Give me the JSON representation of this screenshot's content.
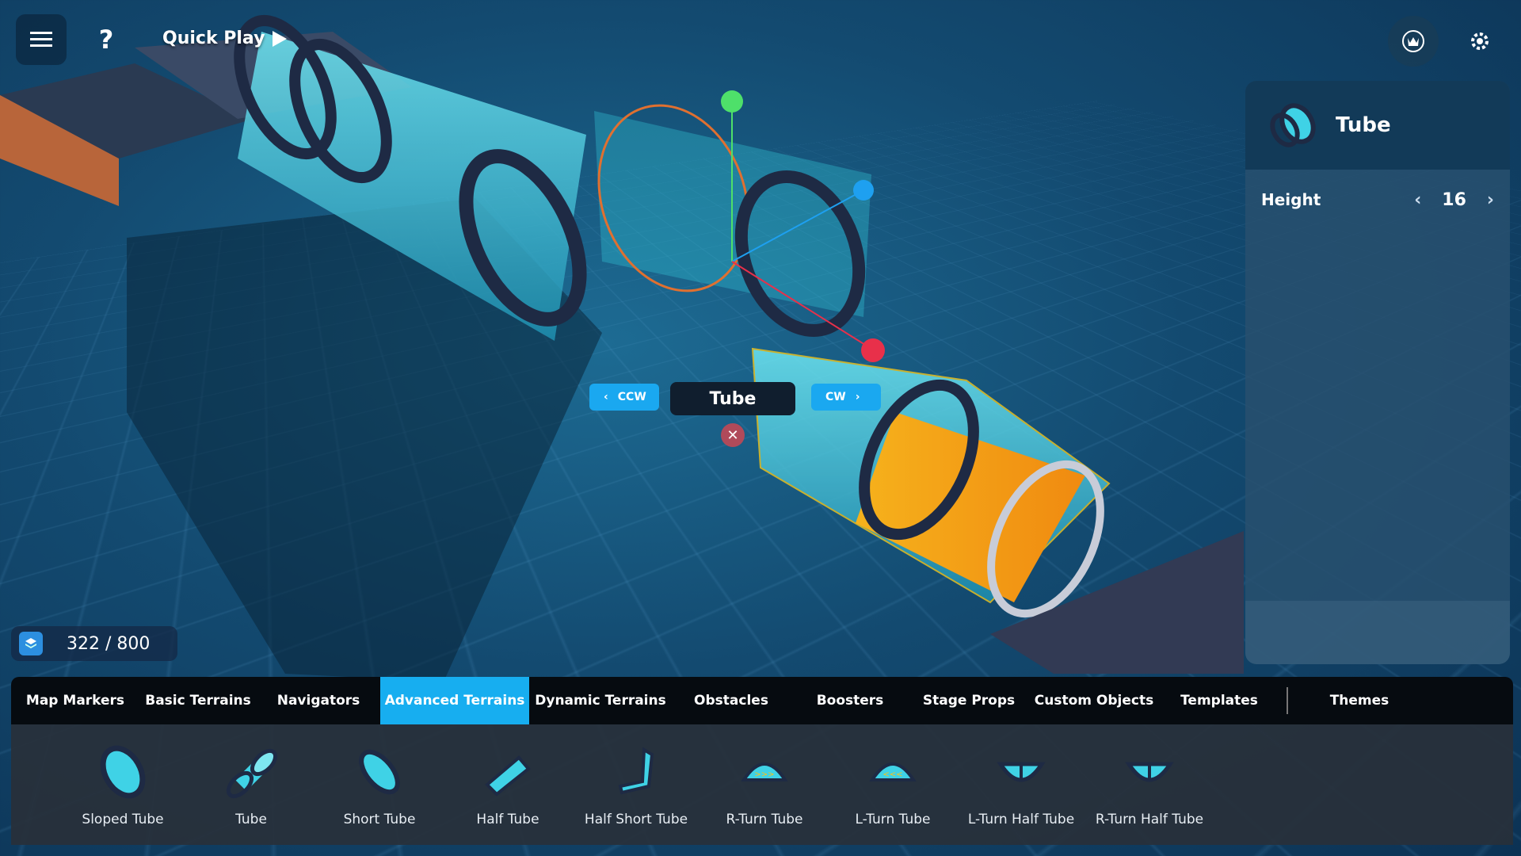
{
  "top_bar": {
    "quick_play_label": "Quick Play"
  },
  "selection": {
    "name": "Tube",
    "ccw_label": "CCW",
    "cw_label": "CW"
  },
  "counter": {
    "value": "322 / 800"
  },
  "panel": {
    "title": "Tube",
    "property_label": "Height",
    "property_value": "16"
  },
  "tabs": [
    {
      "label": "Map Markers"
    },
    {
      "label": "Basic Terrains"
    },
    {
      "label": "Navigators"
    },
    {
      "label": "Advanced Terrains"
    },
    {
      "label": "Dynamic Terrains"
    },
    {
      "label": "Obstacles"
    },
    {
      "label": "Boosters"
    },
    {
      "label": "Stage Props"
    },
    {
      "label": "Custom Objects"
    },
    {
      "label": "Templates"
    },
    {
      "label": "Themes"
    }
  ],
  "active_tab": "Advanced Terrains",
  "items": [
    {
      "label": "Sloped Tube",
      "icon": "sloped-tube-icon"
    },
    {
      "label": "Tube",
      "icon": "tube-icon"
    },
    {
      "label": "Short Tube",
      "icon": "short-tube-icon"
    },
    {
      "label": "Half Tube",
      "icon": "half-tube-icon"
    },
    {
      "label": "Half Short Tube",
      "icon": "half-short-tube-icon"
    },
    {
      "label": "R-Turn Tube",
      "icon": "r-turn-tube-icon"
    },
    {
      "label": "L-Turn Tube",
      "icon": "l-turn-tube-icon"
    },
    {
      "label": "L-Turn Half Tube",
      "icon": "l-turn-half-tube-icon"
    },
    {
      "label": "R-Turn Half Tube",
      "icon": "r-turn-half-tube-icon"
    }
  ],
  "colors": {
    "accent": "#17aef0",
    "tube": "#3fd2e6",
    "gizmo_y": "#4ee06a",
    "gizmo_x": "#e8304a",
    "gizmo_z": "#1ea0f0"
  }
}
